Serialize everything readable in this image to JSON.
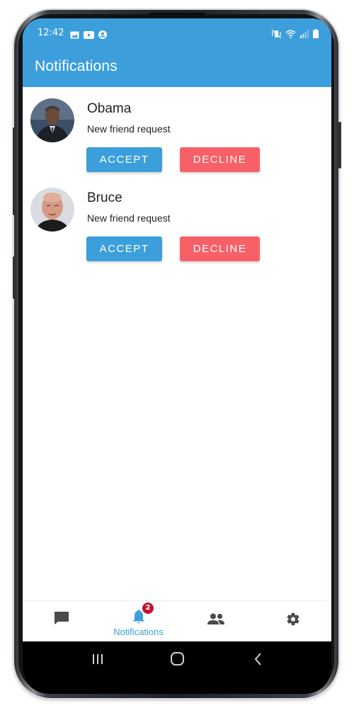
{
  "status_bar": {
    "time": "12:42",
    "left_icons": [
      "image-icon",
      "youtube-icon",
      "account-icon"
    ],
    "right_icons": [
      "mute-vibrate-icon",
      "wifi-icon",
      "signal-icon",
      "battery-icon"
    ]
  },
  "app_bar": {
    "title": "Notifications",
    "color": "#3c9fdc"
  },
  "notifications": [
    {
      "name": "Obama",
      "message": "New friend request",
      "accept_label": "ACCEPT",
      "decline_label": "DECLINE"
    },
    {
      "name": "Bruce",
      "message": "New friend request",
      "accept_label": "ACCEPT",
      "decline_label": "DECLINE"
    }
  ],
  "tab_bar": {
    "tabs": [
      {
        "icon": "chat-icon",
        "active": false
      },
      {
        "icon": "bell-icon",
        "label": "Notifications",
        "badge": "2",
        "active": true
      },
      {
        "icon": "people-icon",
        "active": false
      },
      {
        "icon": "gear-icon",
        "active": false
      }
    ],
    "active_color": "#3c9fdc",
    "inactive_color": "#4a4a4a",
    "badge_color": "#c0162a"
  },
  "colors": {
    "accept": "#3c9fdc",
    "decline": "#f86067"
  },
  "nav_bar": {
    "buttons": [
      "recent-apps-icon",
      "home-icon",
      "back-icon"
    ]
  }
}
